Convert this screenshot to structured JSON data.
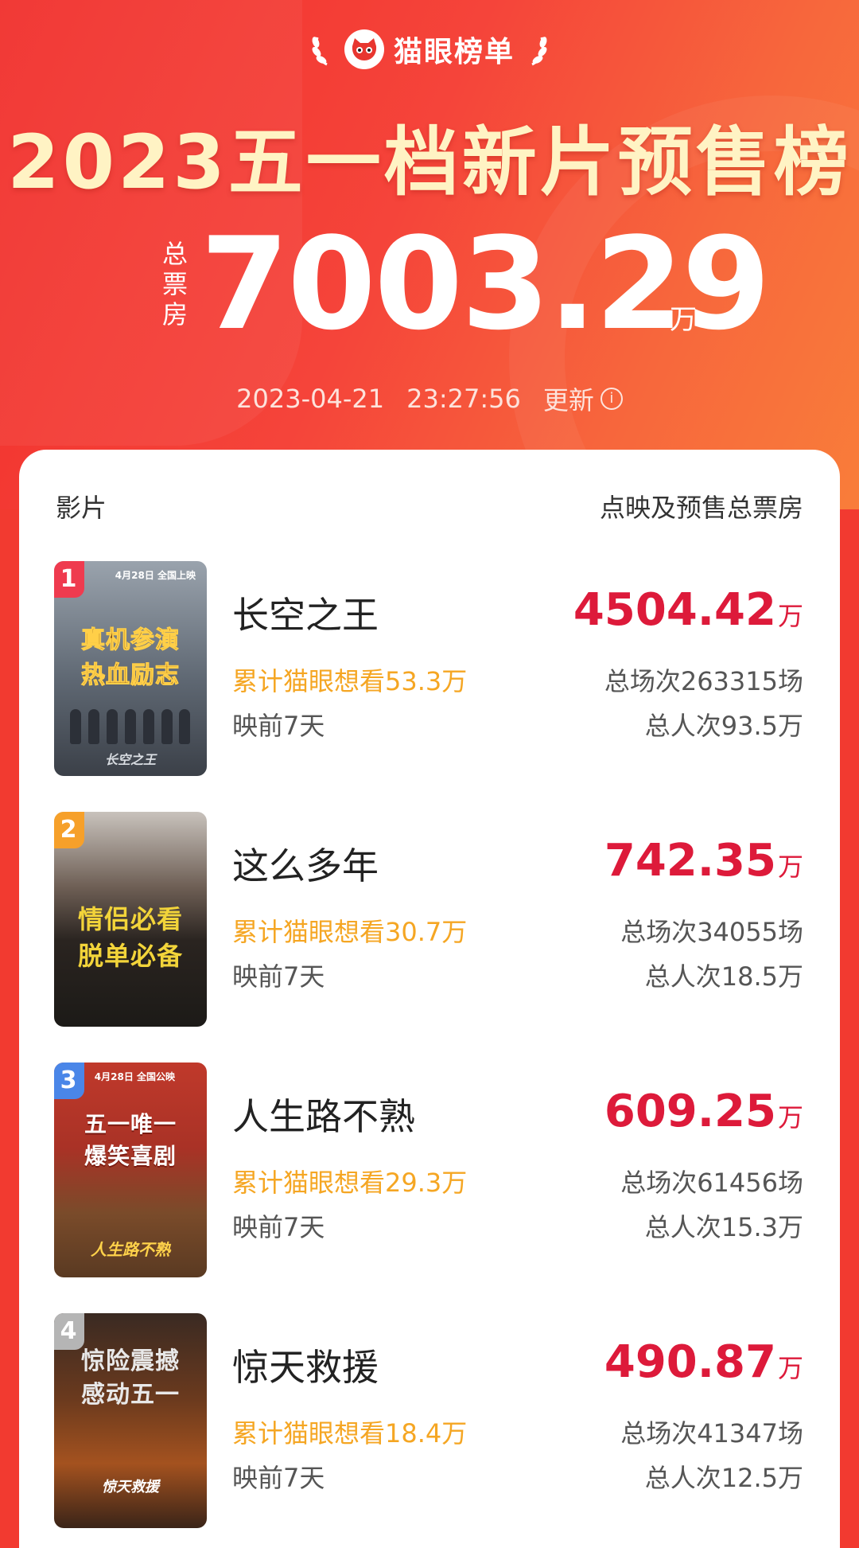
{
  "header": {
    "brand": "猫眼榜单",
    "title": "2023五一档新片预售榜",
    "total_label": "总票房",
    "total_value": "7003.29",
    "total_unit": "万",
    "update_date": "2023-04-21",
    "update_time": "23:27:56",
    "update_label": "更新"
  },
  "table": {
    "col_left": "影片",
    "col_right": "点映及预售总票房"
  },
  "movies": [
    {
      "rank": "1",
      "name": "长空之王",
      "want": "累计猫眼想看53.3万",
      "release": "映前7天",
      "gross": "4504.42",
      "gross_unit": "万",
      "shows": "总场次263315场",
      "viewers": "总人次93.5万",
      "poster_tagline": "真机参演热血励志",
      "poster_note": "4月28日 全国上映",
      "poster_logo": "长空之王",
      "rank_color": "#ef3b4f"
    },
    {
      "rank": "2",
      "name": "这么多年",
      "want": "累计猫眼想看30.7万",
      "release": "映前7天",
      "gross": "742.35",
      "gross_unit": "万",
      "shows": "总场次34055场",
      "viewers": "总人次18.5万",
      "poster_tagline": "情侣必看脱单必备",
      "poster_note": "",
      "poster_logo": "",
      "rank_color": "#f6a02a"
    },
    {
      "rank": "3",
      "name": "人生路不熟",
      "want": "累计猫眼想看29.3万",
      "release": "映前7天",
      "gross": "609.25",
      "gross_unit": "万",
      "shows": "总场次61456场",
      "viewers": "总人次15.3万",
      "poster_tagline": "五一唯一爆笑喜剧",
      "poster_note": "4月28日 全国公映",
      "poster_logo": "人生路不熟",
      "rank_color": "#4a86e8"
    },
    {
      "rank": "4",
      "name": "惊天救援",
      "want": "累计猫眼想看18.4万",
      "release": "映前7天",
      "gross": "490.87",
      "gross_unit": "万",
      "shows": "总场次41347场",
      "viewers": "总人次12.5万",
      "poster_tagline": "惊险震撼感动五一",
      "poster_note": "",
      "poster_logo": "惊天救援",
      "rank_color": "#b5b5b5"
    }
  ],
  "colors": {
    "accent_red": "#dd1a3a",
    "want_orange": "#f5a623"
  }
}
